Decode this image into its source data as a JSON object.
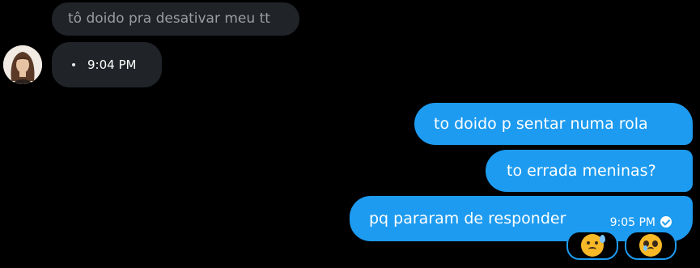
{
  "messages": {
    "quoted": {
      "text": "tô doido pra desativar meu tt"
    },
    "received": {
      "time": "9:04 PM"
    },
    "sent": [
      {
        "text": "to doido p sentar numa rola"
      },
      {
        "text": "to errada meninas?"
      },
      {
        "text": "pq pararam de responder",
        "time": "9:05 PM"
      }
    ]
  },
  "reactions": [
    {
      "icon": "downcast-face-with-sweat-icon"
    },
    {
      "icon": "pleading-face-icon"
    }
  ],
  "colors": {
    "background": "#000000",
    "received_bubble": "#202327",
    "sent_bubble": "#1d9bf0",
    "muted_text": "#9a9ea3"
  }
}
